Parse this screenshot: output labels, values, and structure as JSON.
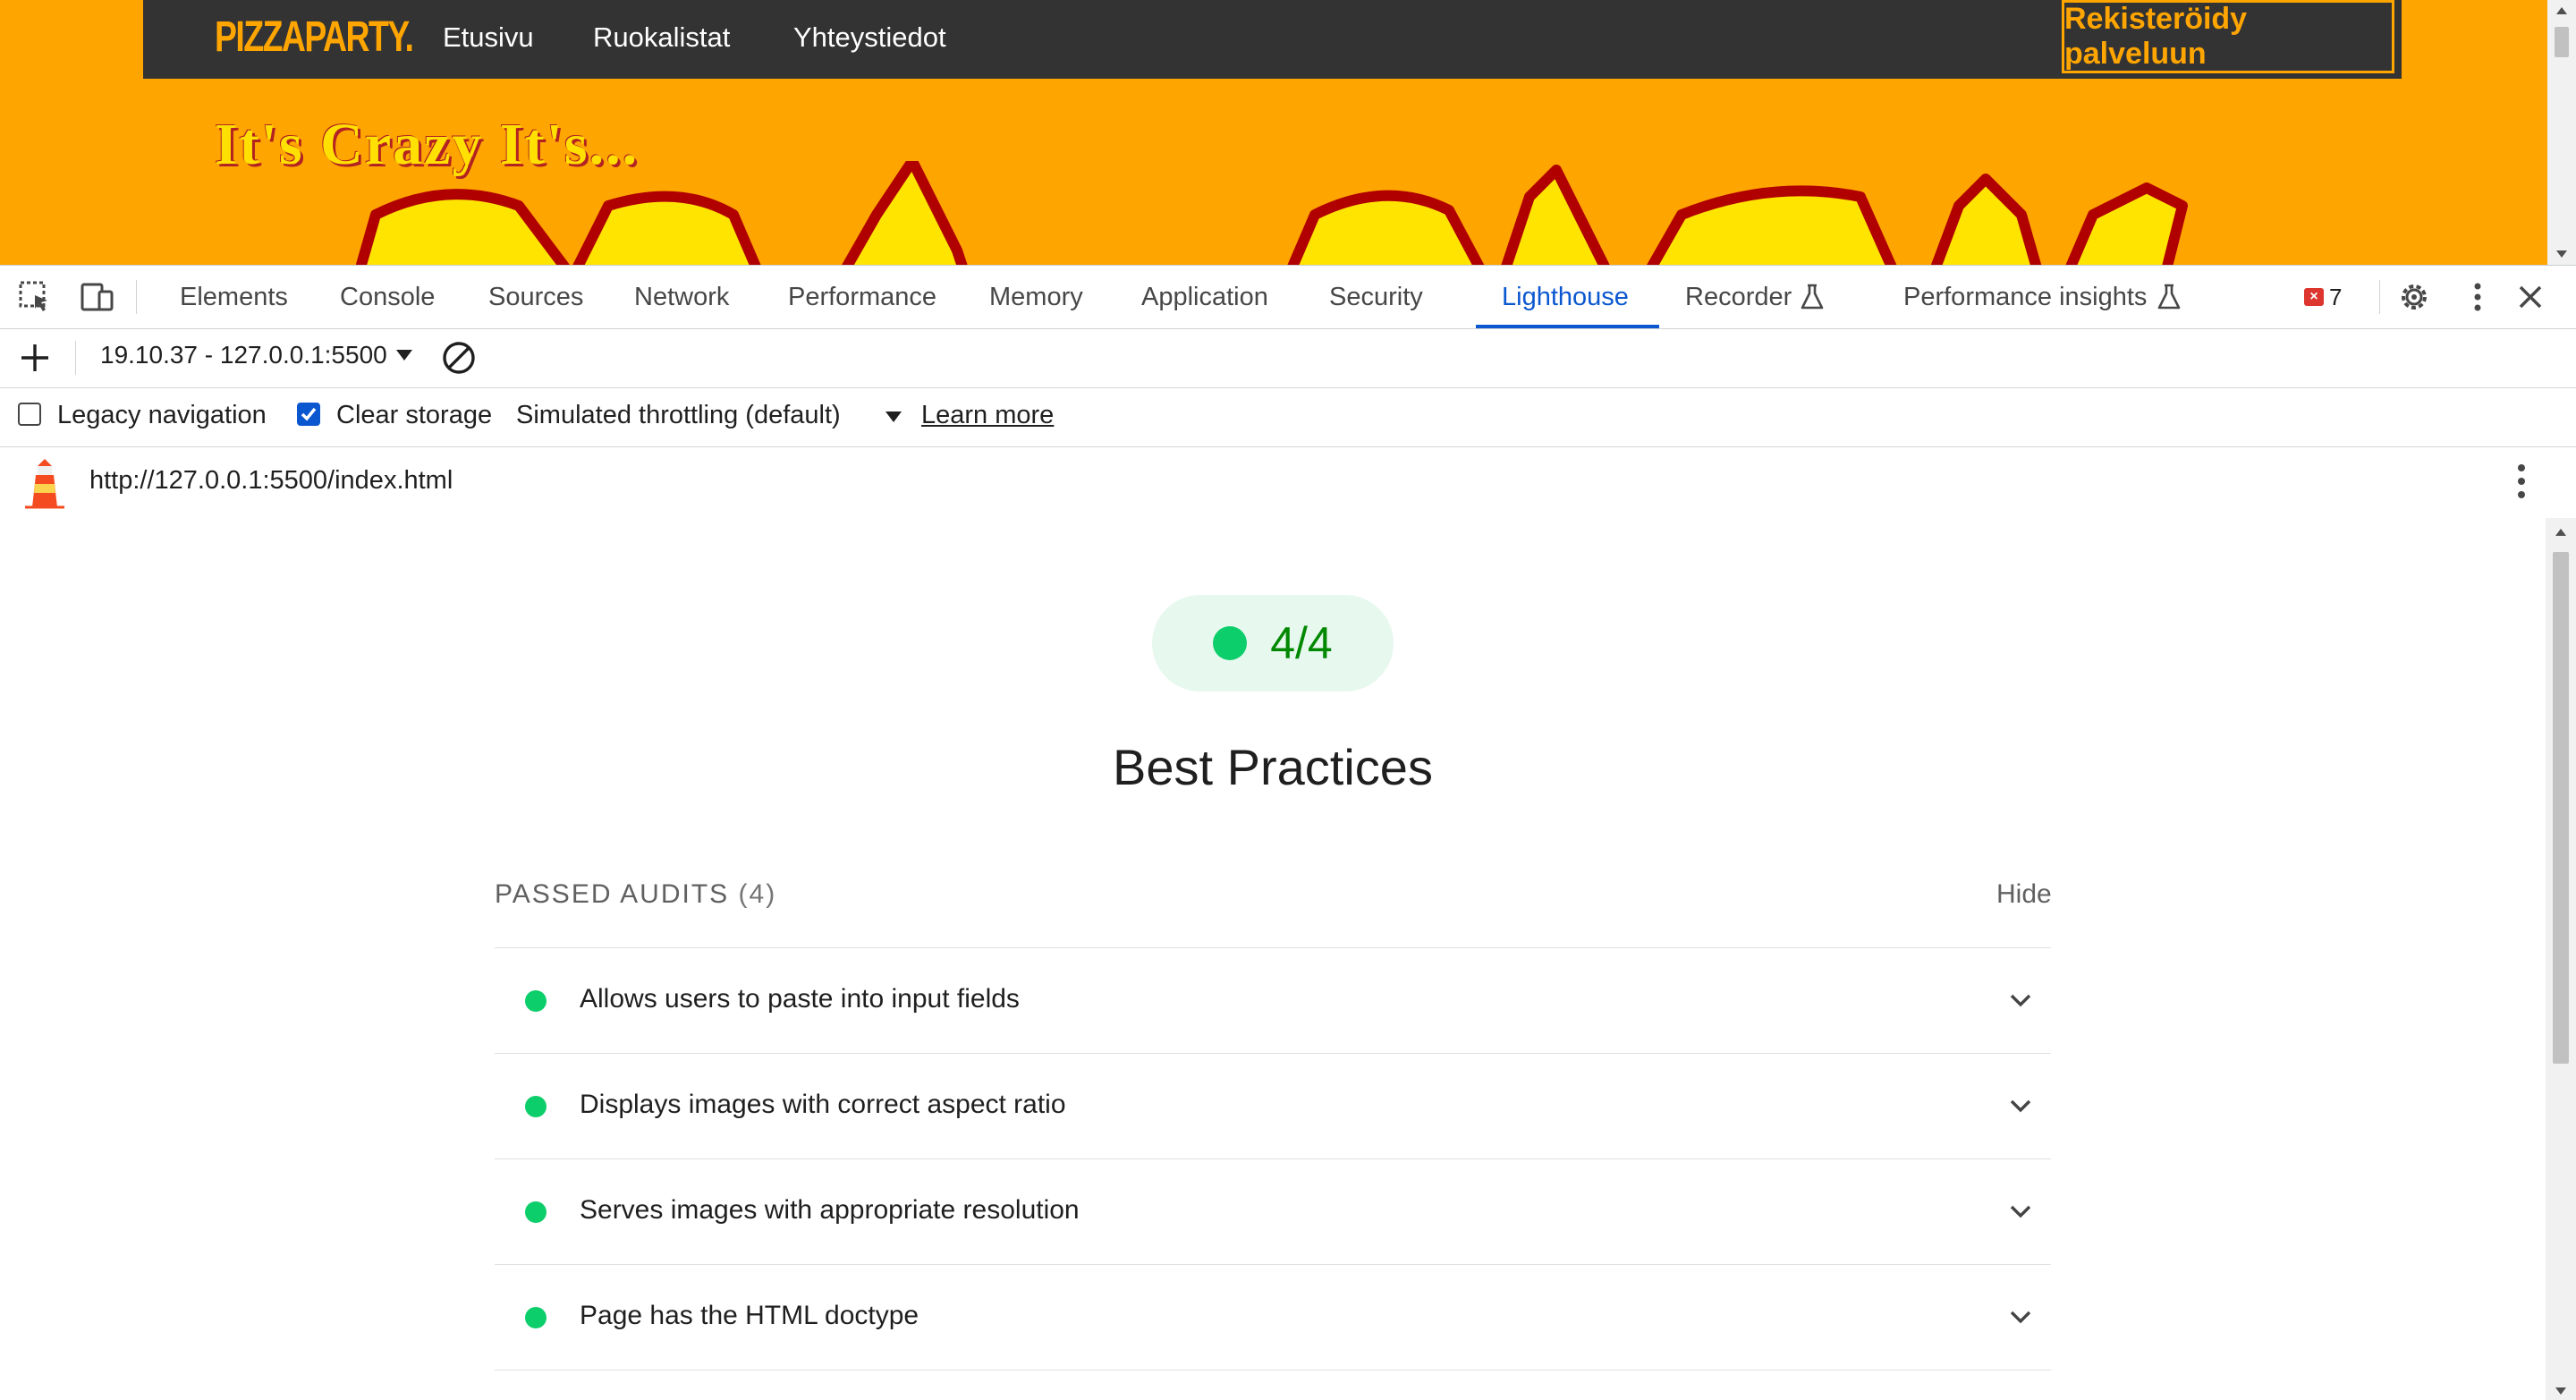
{
  "website": {
    "logo": "PIZZAPARTY.",
    "nav_links": [
      "Etusivu",
      "Ruokalistat",
      "Yhteystiedot"
    ],
    "register_button": "Rekisteröidy palveluun",
    "tagline": "It's Crazy It's...",
    "colors": {
      "background": "#FFA500",
      "nav": "#333333",
      "accent": "#FFA500"
    }
  },
  "devtools": {
    "tabs": [
      {
        "label": "Elements"
      },
      {
        "label": "Console"
      },
      {
        "label": "Sources"
      },
      {
        "label": "Network"
      },
      {
        "label": "Performance"
      },
      {
        "label": "Memory"
      },
      {
        "label": "Application"
      },
      {
        "label": "Security"
      },
      {
        "label": "Lighthouse",
        "active": true
      },
      {
        "label": "Recorder",
        "icon": "flask-icon"
      },
      {
        "label": "Performance insights",
        "icon": "flask-icon"
      }
    ],
    "error_count": "7",
    "report_selector": "19.10.37 - 127.0.0.1:5500",
    "options": {
      "legacy_navigation": {
        "label": "Legacy navigation",
        "checked": false
      },
      "clear_storage": {
        "label": "Clear storage",
        "checked": true
      },
      "throttling": "Simulated throttling (default)",
      "learn_more": "Learn more"
    },
    "url": "http://127.0.0.1:5500/index.html"
  },
  "report": {
    "score": "4/4",
    "category_title": "Best Practices",
    "passed_audits_label": "PASSED AUDITS",
    "passed_audits_count": "(4)",
    "hide_label": "Hide",
    "audits": [
      "Allows users to paste into input fields",
      "Displays images with correct aspect ratio",
      "Serves images with appropriate resolution",
      "Page has the HTML doctype"
    ],
    "colors": {
      "pass": "#0cce6b",
      "pass_text": "#008800",
      "pill_bg": "#e7f8ef",
      "active_tab": "#0b57d0"
    }
  }
}
